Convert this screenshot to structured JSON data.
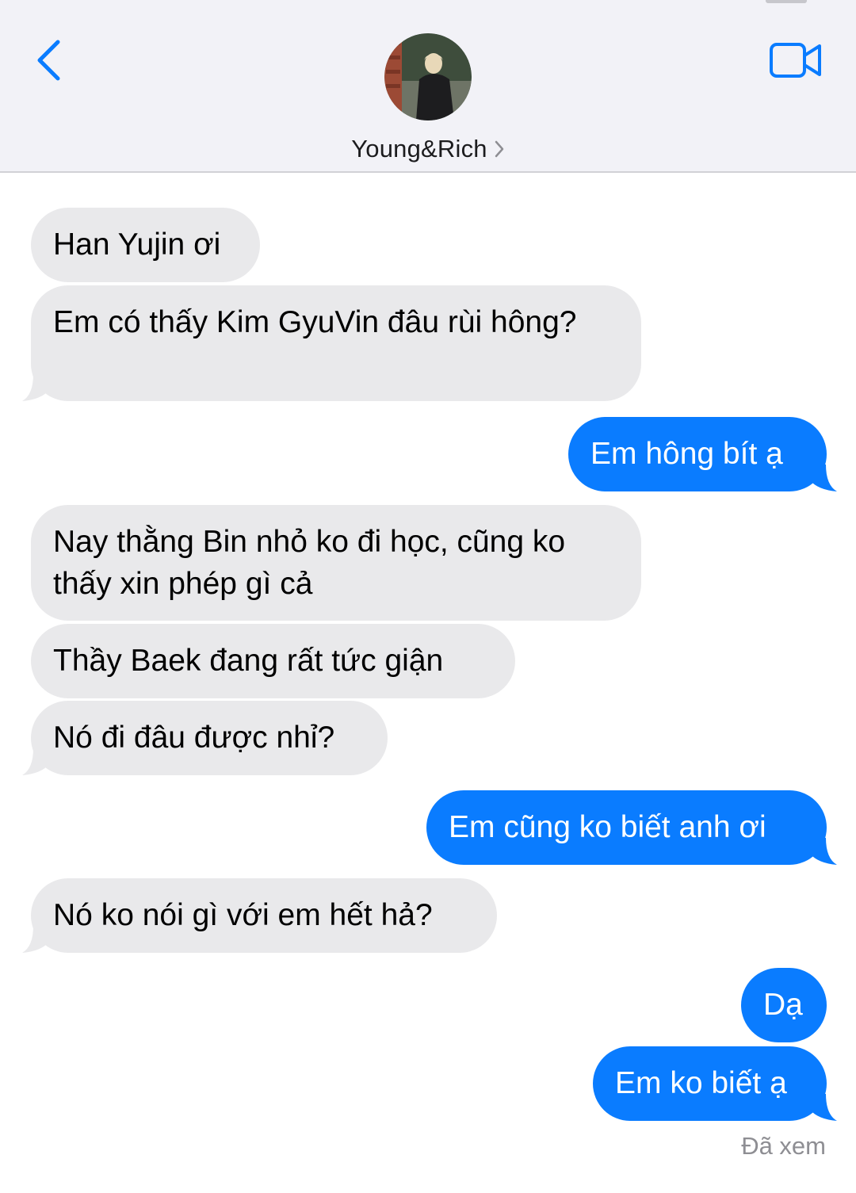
{
  "header": {
    "contact_name": "Young&Rich",
    "back_icon": "chevron-left-icon",
    "video_icon": "video-camera-icon",
    "accent_color": "#0a7cff"
  },
  "messages": [
    {
      "direction": "incoming",
      "text": "Han Yujin ơi"
    },
    {
      "direction": "incoming",
      "text": "Em có thấy Kim GyuVin đâu rùi hông?"
    },
    {
      "direction": "outgoing",
      "text": "Em hông bít ạ"
    },
    {
      "direction": "incoming",
      "text": "Nay thằng Bin nhỏ ko đi học, cũng ko thấy xin phép gì cả"
    },
    {
      "direction": "incoming",
      "text": "Thầy Baek đang rất tức giận"
    },
    {
      "direction": "incoming",
      "text": "Nó đi đâu được nhỉ?"
    },
    {
      "direction": "outgoing",
      "text": "Em cũng ko biết anh ơi"
    },
    {
      "direction": "incoming",
      "text": "Nó ko nói gì với em hết hả?"
    },
    {
      "direction": "outgoing",
      "text": "Dạ"
    },
    {
      "direction": "outgoing",
      "text": "Em ko biết ạ"
    }
  ],
  "status": {
    "read_receipt": "Đã xem"
  }
}
